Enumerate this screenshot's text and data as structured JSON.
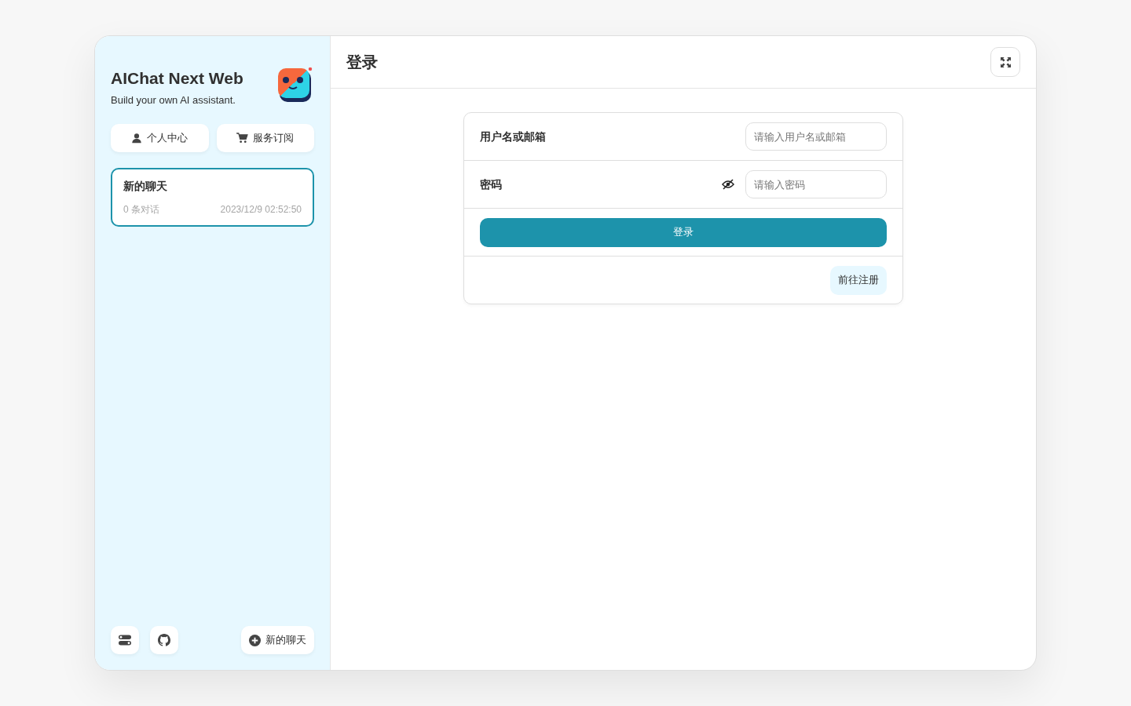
{
  "sidebar": {
    "title": "AIChat Next Web",
    "subtitle": "Build your own AI assistant.",
    "actions": [
      {
        "label": "个人中心",
        "kind": "user"
      },
      {
        "label": "服务订阅",
        "kind": "cart"
      }
    ],
    "chats": [
      {
        "title": "新的聊天",
        "count": "0 条对话",
        "time": "2023/12/9 02:52:50",
        "selected": true
      }
    ],
    "footer": {
      "new_chat": "新的聊天"
    }
  },
  "main": {
    "title": "登录",
    "form": {
      "fields": [
        {
          "label": "用户名或邮箱",
          "placeholder": "请输入用户名或邮箱",
          "kind": "text"
        },
        {
          "label": "密码",
          "placeholder": "请输入密码",
          "kind": "password"
        }
      ],
      "submit": "登录",
      "register": "前往注册"
    }
  }
}
